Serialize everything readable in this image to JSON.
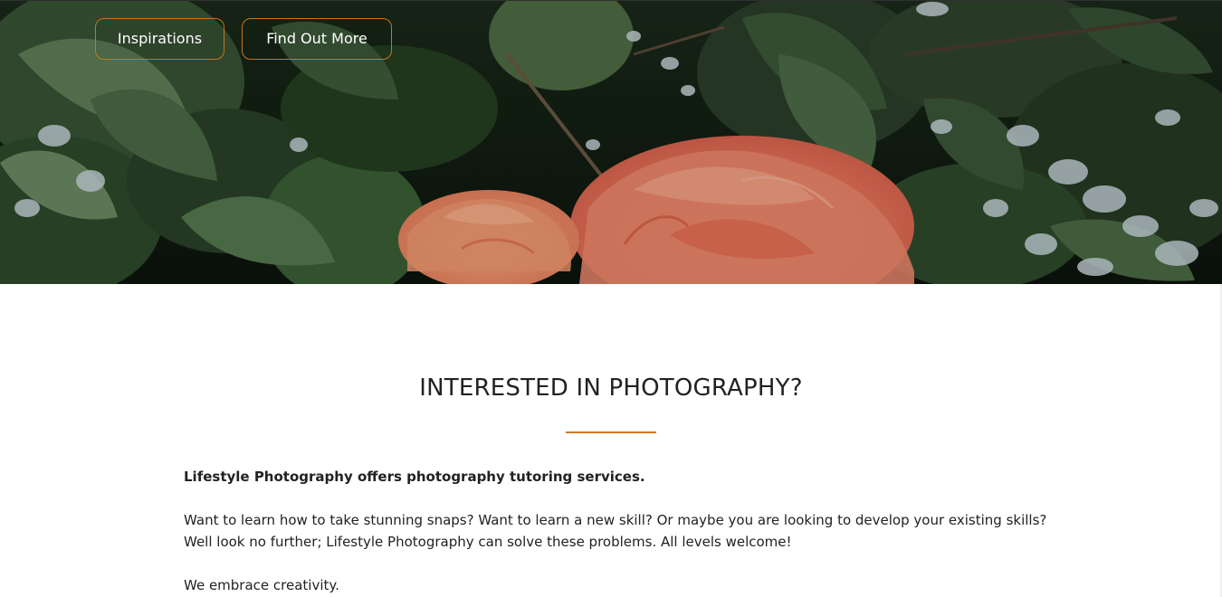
{
  "hero": {
    "buttons": {
      "inspirations": "Inspirations",
      "find_out_more": "Find Out More"
    },
    "accent_color": "#c9741f"
  },
  "section": {
    "title": "INTERESTED IN PHOTOGRAPHY?",
    "rule_color": "#d07a2a",
    "lead": "Lifestyle Photography offers photography tutoring services.",
    "paragraph_1": "Want to learn how to take stunning snaps? Want to learn a new skill? Or maybe you are looking to develop your existing skills? Well look no further; Lifestyle Photography can solve these problems. All levels welcome!",
    "paragraph_2": "We embrace creativity."
  }
}
